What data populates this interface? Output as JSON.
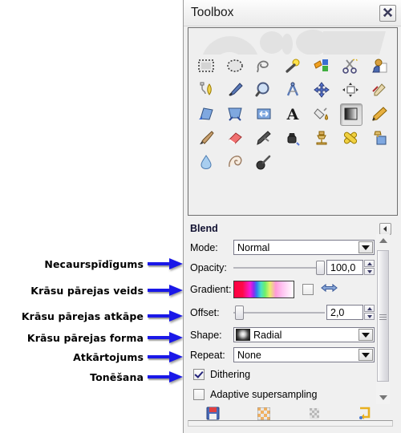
{
  "window": {
    "title": "Toolbox",
    "close_icon": "close-x-icon"
  },
  "toolbox": {
    "tools": [
      {
        "name": "rect-select-tool",
        "icon": "rectangle-select-icon"
      },
      {
        "name": "ellipse-select-tool",
        "icon": "ellipse-select-icon"
      },
      {
        "name": "free-select-tool",
        "icon": "lasso-icon"
      },
      {
        "name": "fuzzy-select-tool",
        "icon": "magic-wand-icon"
      },
      {
        "name": "select-by-color-tool",
        "icon": "color-select-icon"
      },
      {
        "name": "scissors-select-tool",
        "icon": "scissors-icon"
      },
      {
        "name": "foreground-select-tool",
        "icon": "foreground-select-icon"
      },
      {
        "name": "paths-tool",
        "icon": "path-pen-icon"
      },
      {
        "name": "color-picker-tool",
        "icon": "eyedropper-icon"
      },
      {
        "name": "zoom-tool",
        "icon": "magnifier-icon"
      },
      {
        "name": "measure-tool",
        "icon": "compass-icon"
      },
      {
        "name": "move-tool",
        "icon": "move-cross-icon"
      },
      {
        "name": "align-tool",
        "icon": "align-icon"
      },
      {
        "name": "crop-tool",
        "icon": "crop-knife-icon"
      },
      {
        "name": "rotate-tool",
        "icon": "rotate-icon"
      },
      {
        "name": "scale-tool",
        "icon": "scale-icon"
      },
      {
        "name": "shear-tool",
        "icon": "shear-icon"
      },
      {
        "name": "perspective-tool",
        "icon": "perspective-icon"
      },
      {
        "name": "flip-tool",
        "icon": "flip-icon"
      },
      {
        "name": "text-tool",
        "icon": "text-a-icon"
      },
      {
        "name": "bucket-fill-tool",
        "icon": "bucket-fill-icon"
      },
      {
        "name": "blend-tool",
        "icon": "gradient-square-icon",
        "selected": true
      },
      {
        "name": "pencil-tool",
        "icon": "pencil-icon"
      },
      {
        "name": "paintbrush-tool",
        "icon": "paintbrush-icon"
      },
      {
        "name": "eraser-tool",
        "icon": "eraser-icon"
      },
      {
        "name": "airbrush-tool",
        "icon": "airbrush-icon"
      },
      {
        "name": "ink-tool",
        "icon": "ink-pen-icon"
      },
      {
        "name": "clone-tool",
        "icon": "clone-stamp-icon"
      },
      {
        "name": "heal-tool",
        "icon": "heal-bandage-icon"
      },
      {
        "name": "perspective-clone-tool",
        "icon": "perspective-clone-icon"
      },
      {
        "name": "blur-sharpen-tool",
        "icon": "water-drop-icon"
      },
      {
        "name": "smudge-tool",
        "icon": "smudge-finger-icon"
      },
      {
        "name": "dodge-burn-tool",
        "icon": "dodge-burn-icon"
      }
    ],
    "selected_tool_highlight": "red-circle-annotation",
    "colors": {
      "foreground": "#5ef04a",
      "background": "#ffffff",
      "swap_icon": "swap-colors-icon",
      "reset_icon": "reset-colors-icon"
    }
  },
  "options_panel": {
    "heading": "Blend",
    "collapse_icon": "collapse-left-icon",
    "mode": {
      "label": "Mode:",
      "value": "Normal"
    },
    "opacity": {
      "label": "Opacity:",
      "value": "100,0",
      "slider_percent": 97
    },
    "gradient": {
      "label": "Gradient:",
      "reverse_checkbox_checked": false,
      "reverse_icon": "reverse-arrows-icon"
    },
    "offset": {
      "label": "Offset:",
      "value": "2,0",
      "slider_percent": 2
    },
    "shape": {
      "label": "Shape:",
      "value": "Radial",
      "swatch_icon": "radial-gradient-swatch-icon"
    },
    "repeat": {
      "label": "Repeat:",
      "value": "None"
    },
    "dithering": {
      "label": "Dithering",
      "checked": true
    },
    "adaptive_supersampling": {
      "label": "Adaptive supersampling",
      "checked": false
    },
    "bottom_buttons": [
      {
        "name": "save-options-button",
        "icon": "floppy-save-icon"
      },
      {
        "name": "restore-options-button",
        "icon": "checker-restore-icon"
      },
      {
        "name": "delete-options-button",
        "icon": "checker-delete-icon"
      },
      {
        "name": "reset-options-button",
        "icon": "reset-arrow-icon"
      }
    ],
    "scrollbar": {
      "up_icon": "scroll-up-arrow-icon",
      "down_icon": "scroll-down-arrow-icon"
    }
  },
  "annotations": [
    {
      "label": "Necaurspīdīgums",
      "target": "opacity-row"
    },
    {
      "label": "Krāsu pārejas veids",
      "target": "gradient-row"
    },
    {
      "label": "Krāsu pārejas atkāpe",
      "target": "offset-row"
    },
    {
      "label": "Krāsu pārejas forma",
      "target": "shape-row"
    },
    {
      "label": "Atkārtojums",
      "target": "repeat-row"
    },
    {
      "label": "Tonēšana",
      "target": "dithering-row"
    }
  ],
  "arrow_color": "#1a18e8"
}
